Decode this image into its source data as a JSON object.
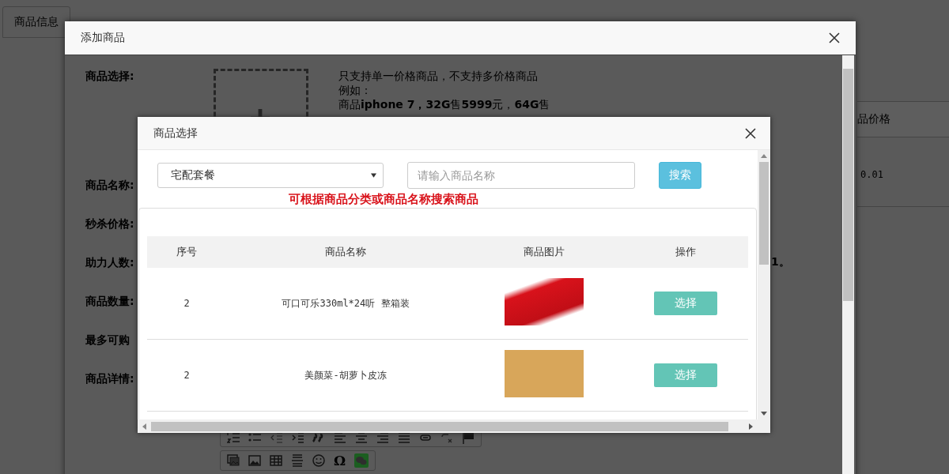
{
  "page": {
    "tabs": [
      {
        "label": "商品信息",
        "selected": false
      }
    ],
    "table": {
      "column": "品价格",
      "cell": "0.01"
    }
  },
  "dialog": {
    "title": "添加商品",
    "fields": [
      {
        "label": "商品选择:"
      },
      {
        "label": "商品名称:"
      },
      {
        "label": "秒杀价格:"
      },
      {
        "label": "助力人数:"
      },
      {
        "label": "商品数量:"
      },
      {
        "label": "最多可购"
      },
      {
        "label": "商品详情:"
      }
    ],
    "note_lines": [
      "只支持单一价格商品，不支持多价格商品",
      "例如：",
      "商品**iphone 7，32G**售**5999**元，**64G**售"
    ],
    "trailing_text": "1。",
    "editor": {
      "symbol_key": "Ω"
    }
  },
  "picker": {
    "title": "商品选择",
    "category": "宅配套餐",
    "search": {
      "placeholder": "请输入商品名称"
    },
    "search_button": "搜索",
    "hint": "可根据商品分类或商品名称搜索商品",
    "columns": [
      "序号",
      "商品名称",
      "商品图片",
      "操作"
    ],
    "rows": [
      {
        "index": "2",
        "name": "可口可乐330ml*24听 整箱装",
        "action": "选择"
      },
      {
        "index": "2",
        "name": "美颜菜-胡萝卜皮冻",
        "action": "选择"
      }
    ]
  }
}
